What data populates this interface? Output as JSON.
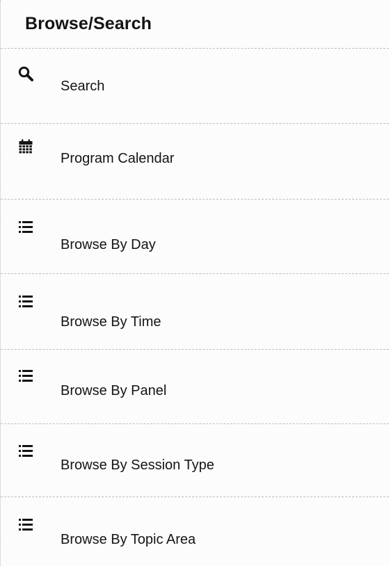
{
  "header": {
    "title": "Browse/Search"
  },
  "menu": {
    "items": [
      {
        "label": "Search",
        "icon": "search-icon"
      },
      {
        "label": "Program Calendar",
        "icon": "calendar-icon"
      },
      {
        "label": "Browse By Day",
        "icon": "list-icon"
      },
      {
        "label": "Browse By Time",
        "icon": "list-icon"
      },
      {
        "label": "Browse By Panel",
        "icon": "list-icon"
      },
      {
        "label": "Browse By Session Type",
        "icon": "list-icon"
      },
      {
        "label": "Browse By Topic Area",
        "icon": "list-icon"
      }
    ]
  },
  "colors": {
    "text": "#141414",
    "divider": "#bdbdbd",
    "background": "#fcfcfc"
  }
}
